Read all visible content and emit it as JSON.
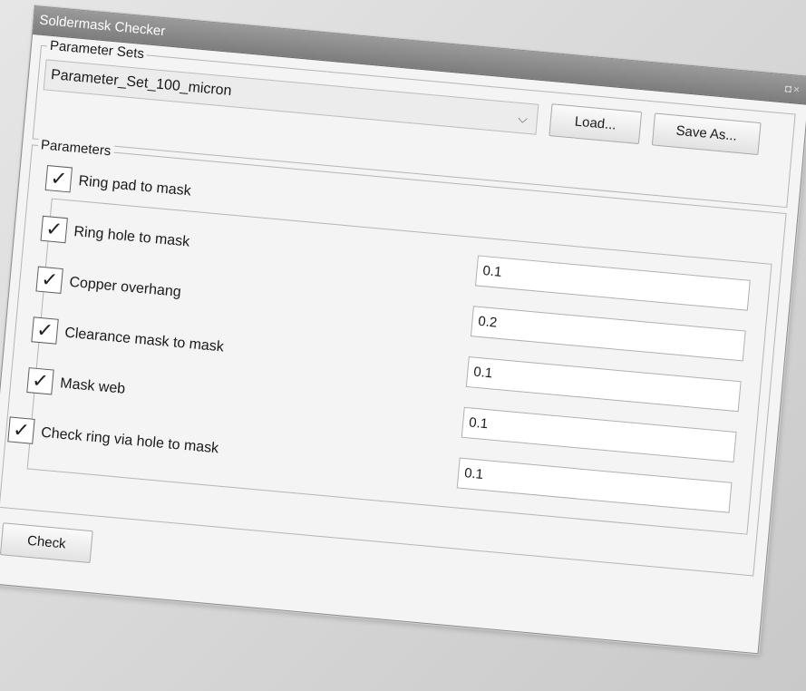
{
  "window": {
    "title": "Soldermask Checker",
    "controls": "◘×"
  },
  "parameter_sets": {
    "legend": "Parameter Sets",
    "selected": "Parameter_Set_100_micron",
    "dropdown_icon": "chevron-down-icon",
    "load_label": "Load...",
    "save_as_label": "Save As..."
  },
  "parameters": {
    "legend": "Parameters",
    "rows": [
      {
        "label": "Ring pad to mask",
        "checked": true,
        "value": "0.1"
      },
      {
        "label": "Ring hole to mask",
        "checked": true,
        "value": "0.2"
      },
      {
        "label": "Copper overhang",
        "checked": true,
        "value": "0.1"
      },
      {
        "label": "Clearance mask to mask",
        "checked": true,
        "value": "0.1"
      },
      {
        "label": "Mask web",
        "checked": true,
        "value": "0.1"
      }
    ],
    "via_row": {
      "label": "Check ring via hole to mask",
      "checked": true
    }
  },
  "actions": {
    "check_label": "Check"
  },
  "check_mark": "✓",
  "chevron": "⌵"
}
